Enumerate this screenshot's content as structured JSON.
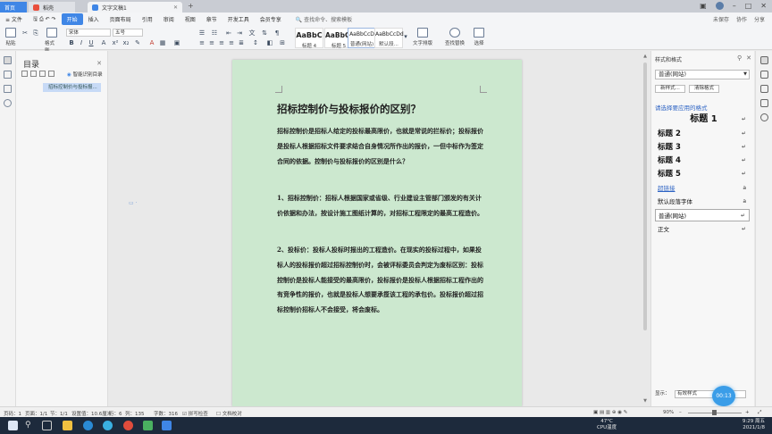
{
  "tabs": {
    "home": "首页",
    "wps": "稻壳",
    "doc": "文字文稿1",
    "add": "+"
  },
  "menu": {
    "file": "≡ 文件",
    "items": [
      "开始",
      "插入",
      "页面布局",
      "引用",
      "审阅",
      "视图",
      "章节",
      "开发工具",
      "会员专享"
    ],
    "search": "查找命令、搜索模板",
    "right": [
      "未保存",
      "协作",
      "分享"
    ]
  },
  "ribbon": {
    "paste": "粘贴",
    "format_painter": "格式刷",
    "font_name": "宋体",
    "font_size": "五号",
    "styles": [
      {
        "preview": "AaBbC",
        "name": "标题 4"
      },
      {
        "preview": "AaBbCc",
        "name": "标题 5"
      },
      {
        "preview": "AaBbCcD",
        "name": "普通(网站)"
      },
      {
        "preview": "AaBbCcDd",
        "name": "默认段..."
      }
    ],
    "text_tools": "文字排版",
    "find_replace": "查找替换",
    "select": "选择"
  },
  "nav": {
    "title": "目录",
    "smart": "智能识别目录",
    "entry": "招标控制价与投标报..."
  },
  "document": {
    "title": "招标控制价与投标报价的区别？",
    "p1": "招标控制价是招标人给定的投标最高限价，也就是常说的拦标价；投标报价是投标人根据招标文件要求结合自身情况所作出的报价，一但中标作为签定合同的依据。控制价与投标报价的区别是什么？",
    "p2": "1、招标控制价：招标人根据国家或省级、行业建设主管部门颁发的有关计价依据和办法，按设计施工图纸计算的，对招标工程限定的最高工程造价。",
    "p3": "2、投标价：投标人投标时报出的工程造价。在现实的投标过程中，如果投标人的投标报价超过招标控制价时，会被评标委员会判定为废标区别：投标控制价是投标人能接受的最高限价，投标报价是投标人根据招标工程作出的有竞争性的报价，也就是投标人想要承揽该工程的承包价。投标报价超过招标控制价招标人不会接受，将会废标。"
  },
  "style_pane": {
    "title": "样式和格式",
    "current": "普通(网站)",
    "new_style": "新样式...",
    "clear_format": "清除格式",
    "hint": "请选择要应用的格式",
    "items": [
      {
        "label": "标题  1",
        "mark": "↵"
      },
      {
        "label": "标题  2",
        "mark": "↵"
      },
      {
        "label": "标题  3",
        "mark": "↵"
      },
      {
        "label": "标题  4",
        "mark": "↵"
      },
      {
        "label": "标题  5",
        "mark": "↵"
      },
      {
        "label": "超链接",
        "mark": "a"
      },
      {
        "label": "默认段落字体",
        "mark": "a"
      },
      {
        "label": "普通(网站)",
        "mark": "↵"
      },
      {
        "label": "正文",
        "mark": "↵"
      }
    ],
    "show_label": "显示：",
    "show_value": "有效样式"
  },
  "float_badge": "00:13",
  "status": {
    "page": "页码：1",
    "pages": "页面：1/1",
    "section": "节：1/1",
    "setting": "设置值：10.6厘米",
    "row": "行：6",
    "col": "列：135",
    "words": "字数：316",
    "spell": "拼写检查",
    "proof": "文档校对",
    "zoom": "90%"
  },
  "taskbar": {
    "temp": "47°C",
    "cpu": "CPU温度",
    "time": "9:29 周五",
    "date": "2021/1/8"
  },
  "colors": {
    "accent": "#3f86e6",
    "page_bg": "#cce8cf",
    "link": "#2e64c4"
  }
}
